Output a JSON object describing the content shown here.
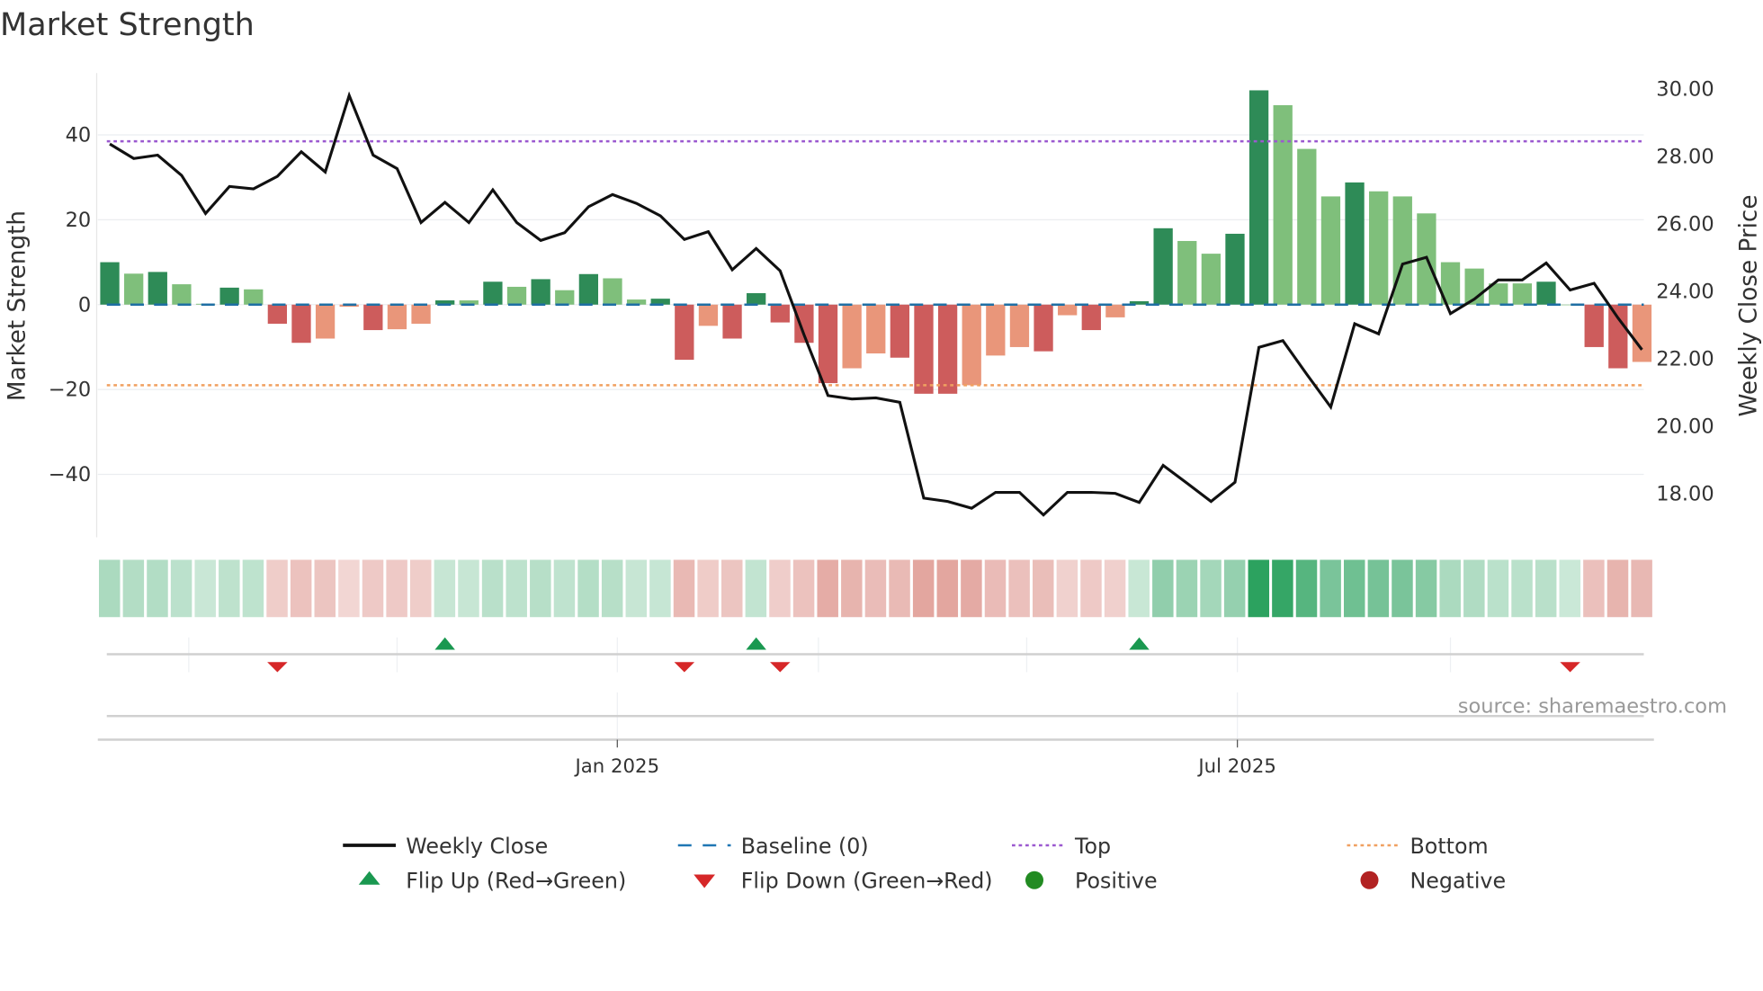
{
  "chart_data": {
    "type": "bar+line",
    "title": "Market Strength",
    "ylabel_left": "Market Strength",
    "ylabel_right": "Weekly Close Price",
    "left_ticks": [
      "40",
      "20",
      "0",
      "−40"
    ],
    "left_tick_values": [
      40,
      20,
      0,
      -20,
      -40
    ],
    "left_tick_labels": [
      "40",
      "20",
      "0",
      "−20",
      "−40"
    ],
    "right_tick_values": [
      30,
      28,
      26,
      24,
      22,
      20,
      18
    ],
    "right_tick_labels": [
      "30.00",
      "28.00",
      "26.00",
      "24.00",
      "22.00",
      "20.00",
      "18.00"
    ],
    "ylim_left": [
      -55,
      55
    ],
    "ylim_right": [
      16.8,
      31.4
    ],
    "top_level": 38.5,
    "bottom_level": -19,
    "baseline": 0,
    "x_tick_labels": [
      {
        "label": "Jan 2025",
        "week": 21.7
      },
      {
        "label": "Jul 2025",
        "week": 47.6
      }
    ],
    "month_gridlines_weeks": [
      3.8,
      12.5,
      21.7,
      30.1,
      38.8,
      47.6,
      56.5
    ],
    "strength": [
      10,
      7.3,
      7.7,
      4.8,
      0.2,
      4,
      3.6,
      -4.5,
      -9,
      -8,
      -0.5,
      -6,
      -5.8,
      -4.5,
      1,
      1,
      5.4,
      4.2,
      6,
      3.4,
      7.2,
      6.2,
      1.2,
      1.4,
      -13,
      -5,
      -8,
      2.7,
      -4.2,
      -9,
      -18.5,
      -15,
      -11.5,
      -12.5,
      -21,
      -21,
      -19,
      -12,
      -10,
      -11,
      -2.5,
      -6,
      -3,
      0.8,
      18,
      15,
      12,
      16.7,
      50.5,
      47,
      36.7,
      25.5,
      28.8,
      26.7,
      25.5,
      21.5,
      10,
      8.5,
      5,
      5,
      5.4,
      0,
      -10,
      -15,
      -13.5
    ],
    "shade": [
      "d",
      "l",
      "d",
      "l",
      "l",
      "d",
      "l",
      "d",
      "d",
      "l",
      "l",
      "d",
      "l",
      "l",
      "d",
      "l",
      "d",
      "l",
      "d",
      "l",
      "d",
      "l",
      "l",
      "d",
      "d",
      "l",
      "d",
      "d",
      "d",
      "d",
      "d",
      "l",
      "l",
      "d",
      "d",
      "d",
      "l",
      "l",
      "l",
      "d",
      "l",
      "d",
      "l",
      "d",
      "d",
      "l",
      "l",
      "d",
      "d",
      "l",
      "l",
      "l",
      "d",
      "l",
      "l",
      "l",
      "l",
      "l",
      "l",
      "l",
      "d",
      "l",
      "d",
      "d",
      "l"
    ],
    "weekly_close": [
      28.33,
      27.9,
      28.0,
      27.4,
      26.27,
      27.07,
      27.0,
      27.37,
      28.1,
      27.5,
      29.77,
      28.0,
      27.6,
      26.0,
      26.6,
      26.0,
      26.97,
      26.0,
      25.47,
      25.7,
      26.47,
      26.83,
      26.57,
      26.2,
      25.5,
      25.73,
      24.6,
      25.23,
      24.57,
      22.67,
      20.87,
      20.77,
      20.8,
      20.67,
      17.83,
      17.73,
      17.53,
      18.0,
      18.0,
      17.33,
      18.0,
      18.0,
      17.97,
      17.7,
      18.8,
      18.27,
      17.73,
      18.3,
      22.3,
      22.5,
      21.5,
      20.53,
      23.0,
      22.7,
      24.77,
      24.97,
      23.3,
      23.73,
      24.3,
      24.3,
      24.8,
      24.0,
      24.2,
      23.17,
      22.23
    ],
    "flip_up_weeks": [
      14,
      27,
      43
    ],
    "flip_down_weeks": [
      7,
      24,
      28,
      61
    ],
    "legend": [
      {
        "label": "Weekly Close",
        "symbol": "line",
        "color": "#111111"
      },
      {
        "label": "Baseline (0)",
        "symbol": "dash",
        "color": "#1f77b4"
      },
      {
        "label": "Top",
        "symbol": "dot",
        "color": "#9b59d0"
      },
      {
        "label": "Bottom",
        "symbol": "dot",
        "color": "#f0a060"
      },
      {
        "label": "Flip Up (Red→Green)",
        "symbol": "triangle-up",
        "color": "#1a9850"
      },
      {
        "label": "Flip Down (Green→Red)",
        "symbol": "triangle-down",
        "color": "#d62728"
      },
      {
        "label": "Positive",
        "symbol": "circle",
        "color": "#228b22"
      },
      {
        "label": "Negative",
        "symbol": "circle",
        "color": "#b22222"
      }
    ],
    "legend_placement": "bottom",
    "source": "source: sharemaestro.com"
  },
  "colors": {
    "dark_green": "#2e8b57",
    "light_green": "#7fbf7b",
    "dark_red": "#cd5c5c",
    "light_red": "#e9967a"
  }
}
